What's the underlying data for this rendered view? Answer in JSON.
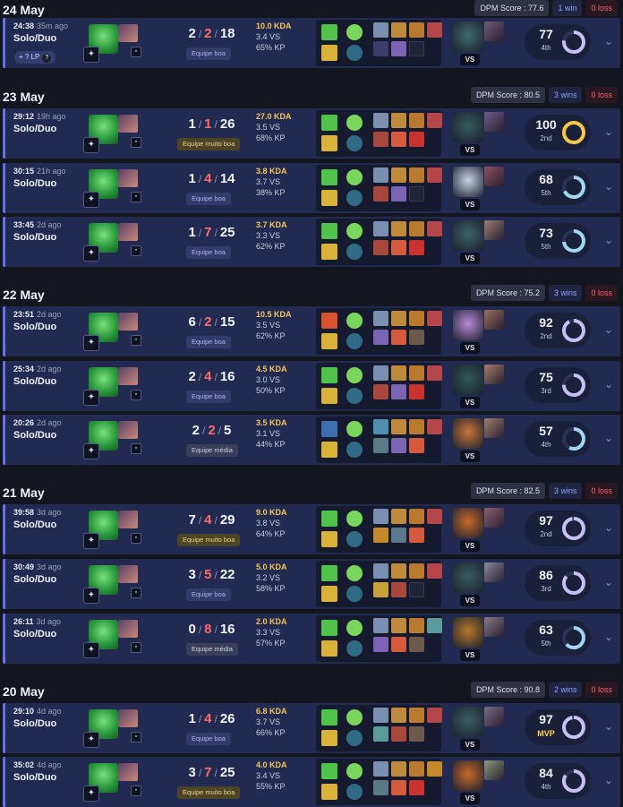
{
  "groups": [
    {
      "date": "24 May",
      "dpm": "DPM Score : 77.6",
      "wins": "1 win",
      "losses": "0 loss",
      "matches": [
        {
          "time": "24:38",
          "ago": "35m ago",
          "queue": "Solo/Duo",
          "lp": "+ ? LP",
          "lp_help": "?",
          "kills": "2",
          "deaths": "2",
          "assists": "18",
          "team": "Equipe boa",
          "team_kind": "boa",
          "kda": "10.0 KDA",
          "vs": "3.4 VS",
          "kp": "65% KP",
          "score": "77",
          "rank": "4th",
          "score_pct": 0.77,
          "ring_color": "#c8bff5",
          "spell1": "#4fc34a",
          "spell2": "#d9b338",
          "rune1": "#7bd65d",
          "rune2": "#2f6b85",
          "items": [
            "#7b8fb0",
            "#c08a3c",
            "#b9792f",
            "#b4464a",
            "#3b3d6a",
            "#7b64b3",
            "empty"
          ],
          "vs_color": "#3f6b6a",
          "vs_duo_color": "#6e5b7a",
          "chevron": "⌄"
        },
        null
      ]
    },
    {
      "date": "23 May",
      "dpm": "DPM Score : 80.5",
      "wins": "3 wins",
      "losses": "0 loss",
      "matches": [
        {
          "time": "29:12",
          "ago": "19h ago",
          "queue": "Solo/Duo",
          "kills": "1",
          "deaths": "1",
          "assists": "26",
          "team": "Equipe muito boa",
          "team_kind": "gold",
          "kda": "27.0 KDA",
          "vs": "3.5 VS",
          "kp": "68% KP",
          "score": "100",
          "rank": "2nd",
          "score_pct": 1.0,
          "ring_color": "#f4c94a",
          "spell1": "#4fc34a",
          "spell2": "#d9b338",
          "rune1": "#7bd65d",
          "rune2": "#2f6b85",
          "items": [
            "#7b8fb0",
            "#c08a3c",
            "#b9792f",
            "#b4464a",
            "#a8473c",
            "#d65a3e",
            "#c9322f"
          ],
          "vs_color": "#355c5a",
          "vs_duo_color": "#6e5b8a",
          "chevron": "⌄"
        },
        {
          "time": "30:15",
          "ago": "21h ago",
          "queue": "Solo/Duo",
          "kills": "1",
          "deaths": "4",
          "assists": "14",
          "team": "Equipe boa",
          "team_kind": "boa",
          "kda": "3.8 KDA",
          "vs": "3.7 VS",
          "kp": "38% KP",
          "score": "68",
          "rank": "5th",
          "score_pct": 0.68,
          "ring_color": "#9fd8f0",
          "spell1": "#4fc34a",
          "spell2": "#d9b338",
          "rune1": "#7bd65d",
          "rune2": "#2f6b85",
          "items": [
            "#7b8fb0",
            "#c08a3c",
            "#b9792f",
            "#b4464a",
            "#a8473c",
            "#7b64b3",
            "empty"
          ],
          "vs_color": "#c9d3e6",
          "vs_duo_color": "#8a5060",
          "chevron": "⌄"
        },
        {
          "time": "33:45",
          "ago": "2d ago",
          "queue": "Solo/Duo",
          "kills": "1",
          "deaths": "7",
          "assists": "25",
          "team": "Equipe boa",
          "team_kind": "boa",
          "kda": "3.7 KDA",
          "vs": "3.3 VS",
          "kp": "62% KP",
          "score": "73",
          "rank": "5th",
          "score_pct": 0.73,
          "ring_color": "#9fd8f0",
          "spell1": "#4fc34a",
          "spell2": "#d9b338",
          "rune1": "#7bd65d",
          "rune2": "#2f6b85",
          "items": [
            "#7b8fb0",
            "#c08a3c",
            "#b9792f",
            "#b4464a",
            "#a8473c",
            "#d65a3e",
            "#c9322f"
          ],
          "vs_color": "#3d6464",
          "vs_duo_color": "#9a8070",
          "chevron": "⌄"
        }
      ]
    },
    {
      "date": "22 May",
      "dpm": "DPM Score : 75.2",
      "wins": "3 wins",
      "losses": "0 loss",
      "matches": [
        {
          "time": "23:51",
          "ago": "2d ago",
          "queue": "Solo/Duo",
          "kills": "6",
          "deaths": "2",
          "assists": "15",
          "team": "Equipe boa",
          "team_kind": "boa",
          "kda": "10.5 KDA",
          "vs": "3.5 VS",
          "kp": "62% KP",
          "score": "92",
          "rank": "2nd",
          "score_pct": 0.92,
          "ring_color": "#c8bff5",
          "spell1": "#d9532e",
          "spell2": "#d9b338",
          "rune1": "#7bd65d",
          "rune2": "#2f6b85",
          "items": [
            "#7b8fb0",
            "#c08a3c",
            "#b9792f",
            "#b4464a",
            "#7b64b3",
            "#d65a3e",
            "#6b5a4a"
          ],
          "vs_color": "#b98ad6",
          "vs_duo_color": "#9a7060",
          "chevron": "⌄"
        },
        {
          "time": "25:34",
          "ago": "2d ago",
          "queue": "Solo/Duo",
          "kills": "2",
          "deaths": "4",
          "assists": "16",
          "team": "Equipe boa",
          "team_kind": "boa",
          "kda": "4.5 KDA",
          "vs": "3.0 VS",
          "kp": "50% KP",
          "score": "75",
          "rank": "3rd",
          "score_pct": 0.75,
          "ring_color": "#c8bff5",
          "spell1": "#4fc34a",
          "spell2": "#d9b338",
          "rune1": "#7bd65d",
          "rune2": "#2f6b85",
          "items": [
            "#7b8fb0",
            "#c08a3c",
            "#b9792f",
            "#b4464a",
            "#a8473c",
            "#7b64b3",
            "#c9322f"
          ],
          "vs_color": "#2f5a52",
          "vs_duo_color": "#a77c6a",
          "chevron": "⌄"
        },
        {
          "time": "20:26",
          "ago": "2d ago",
          "queue": "Solo/Duo",
          "kills": "2",
          "deaths": "2",
          "assists": "5",
          "team": "Equipe média",
          "team_kind": "mid",
          "kda": "3.5 KDA",
          "vs": "3.1 VS",
          "kp": "44% KP",
          "score": "57",
          "rank": "4th",
          "score_pct": 0.57,
          "ring_color": "#9fd8f0",
          "spell1": "#3d6fb0",
          "spell2": "#d9b338",
          "rune1": "#7bd65d",
          "rune2": "#2f6b85",
          "items": [
            "#4f8fb0",
            "#c08a3c",
            "#b9792f",
            "#b4464a",
            "#5a7a8a",
            "#7b64b3",
            "#d65a3e"
          ],
          "vs_color": "#c7763a",
          "vs_duo_color": "#a08070",
          "chevron": "⌄"
        }
      ]
    },
    {
      "date": "21 May",
      "dpm": "DPM Score : 82.5",
      "wins": "3 wins",
      "losses": "0 loss",
      "matches": [
        {
          "time": "39:58",
          "ago": "3d ago",
          "queue": "Solo/Duo",
          "kills": "7",
          "deaths": "4",
          "assists": "29",
          "team": "Equipe muito boa",
          "team_kind": "gold",
          "kda": "9.0 KDA",
          "vs": "3.8 VS",
          "kp": "64% KP",
          "score": "97",
          "rank": "2nd",
          "score_pct": 0.97,
          "ring_color": "#c8bff5",
          "spell1": "#4fc34a",
          "spell2": "#d9b338",
          "rune1": "#7bd65d",
          "rune2": "#2f6b85",
          "items": [
            "#7b8fb0",
            "#c08a3c",
            "#b9792f",
            "#b4464a",
            "#c48a2a",
            "#5a7a8a",
            "#d65a3e"
          ],
          "vs_color": "#c7692a",
          "vs_duo_color": "#8a6070",
          "chevron": "⌄"
        },
        {
          "time": "30:49",
          "ago": "3d ago",
          "queue": "Solo/Duo",
          "kills": "3",
          "deaths": "5",
          "assists": "22",
          "team": "Equipe boa",
          "team_kind": "boa",
          "kda": "5.0 KDA",
          "vs": "3.2 VS",
          "kp": "58% KP",
          "score": "86",
          "rank": "3rd",
          "score_pct": 0.86,
          "ring_color": "#c8bff5",
          "spell1": "#4fc34a",
          "spell2": "#d9b338",
          "rune1": "#7bd65d",
          "rune2": "#2f6b85",
          "items": [
            "#7b8fb0",
            "#c08a3c",
            "#b9792f",
            "#b4464a",
            "#c9a23a",
            "#a8473c",
            "empty"
          ],
          "vs_color": "#3a5e5e",
          "vs_duo_color": "#8a8aa0",
          "chevron": "⌄"
        },
        {
          "time": "26:11",
          "ago": "3d ago",
          "queue": "Solo/Duo",
          "kills": "0",
          "deaths": "8",
          "assists": "16",
          "team": "Equipe média",
          "team_kind": "mid",
          "kda": "2.0 KDA",
          "vs": "3.3 VS",
          "kp": "57% KP",
          "score": "63",
          "rank": "5th",
          "score_pct": 0.63,
          "ring_color": "#9fd8f0",
          "spell1": "#4fc34a",
          "spell2": "#d9b338",
          "rune1": "#7bd65d",
          "rune2": "#2f6b85",
          "items": [
            "#7b8fb0",
            "#c08a3c",
            "#b9792f",
            "#5a9a9a",
            "#7b64b3",
            "#d65a3e",
            "#6b5a4a"
          ],
          "vs_color": "#b8782a",
          "vs_duo_color": "#8a7a8a",
          "chevron": "⌄"
        }
      ]
    },
    {
      "date": "20 May",
      "dpm": "DPM Score : 90.8",
      "wins": "2 wins",
      "losses": "0 loss",
      "matches": [
        {
          "time": "29:10",
          "ago": "4d ago",
          "queue": "Solo/Duo",
          "kills": "1",
          "deaths": "4",
          "assists": "26",
          "team": "Equipe boa",
          "team_kind": "boa",
          "kda": "6.8 KDA",
          "vs": "3.7 VS",
          "kp": "66% KP",
          "score": "97",
          "rank": "MVP",
          "score_pct": 0.97,
          "ring_color": "#c8bff5",
          "spell1": "#4fc34a",
          "spell2": "#d9b338",
          "rune1": "#7bd65d",
          "rune2": "#2f6b85",
          "items": [
            "#7b8fb0",
            "#c08a3c",
            "#b9792f",
            "#b4464a",
            "#5a9a9a",
            "#a8473c",
            "#6b5a4a"
          ],
          "vs_color": "#3a6062",
          "vs_duo_color": "#7a6a8a",
          "chevron": "⌄"
        },
        {
          "time": "35:02",
          "ago": "4d ago",
          "queue": "Solo/Duo",
          "kills": "3",
          "deaths": "7",
          "assists": "25",
          "team": "Equipe muito boa",
          "team_kind": "gold",
          "kda": "4.0 KDA",
          "vs": "3.4 VS",
          "kp": "55% KP",
          "score": "84",
          "rank": "4th",
          "score_pct": 0.84,
          "ring_color": "#c8bff5",
          "spell1": "#4fc34a",
          "spell2": "#d9b338",
          "rune1": "#7bd65d",
          "rune2": "#2f6b85",
          "items": [
            "#7b8fb0",
            "#c08a3c",
            "#b9792f",
            "#c48a2a",
            "#5a7a8a",
            "#d65a3e",
            "#c9322f"
          ],
          "vs_color": "#c7692a",
          "vs_duo_color": "#8a9a7a",
          "chevron": "⌄"
        }
      ]
    }
  ]
}
